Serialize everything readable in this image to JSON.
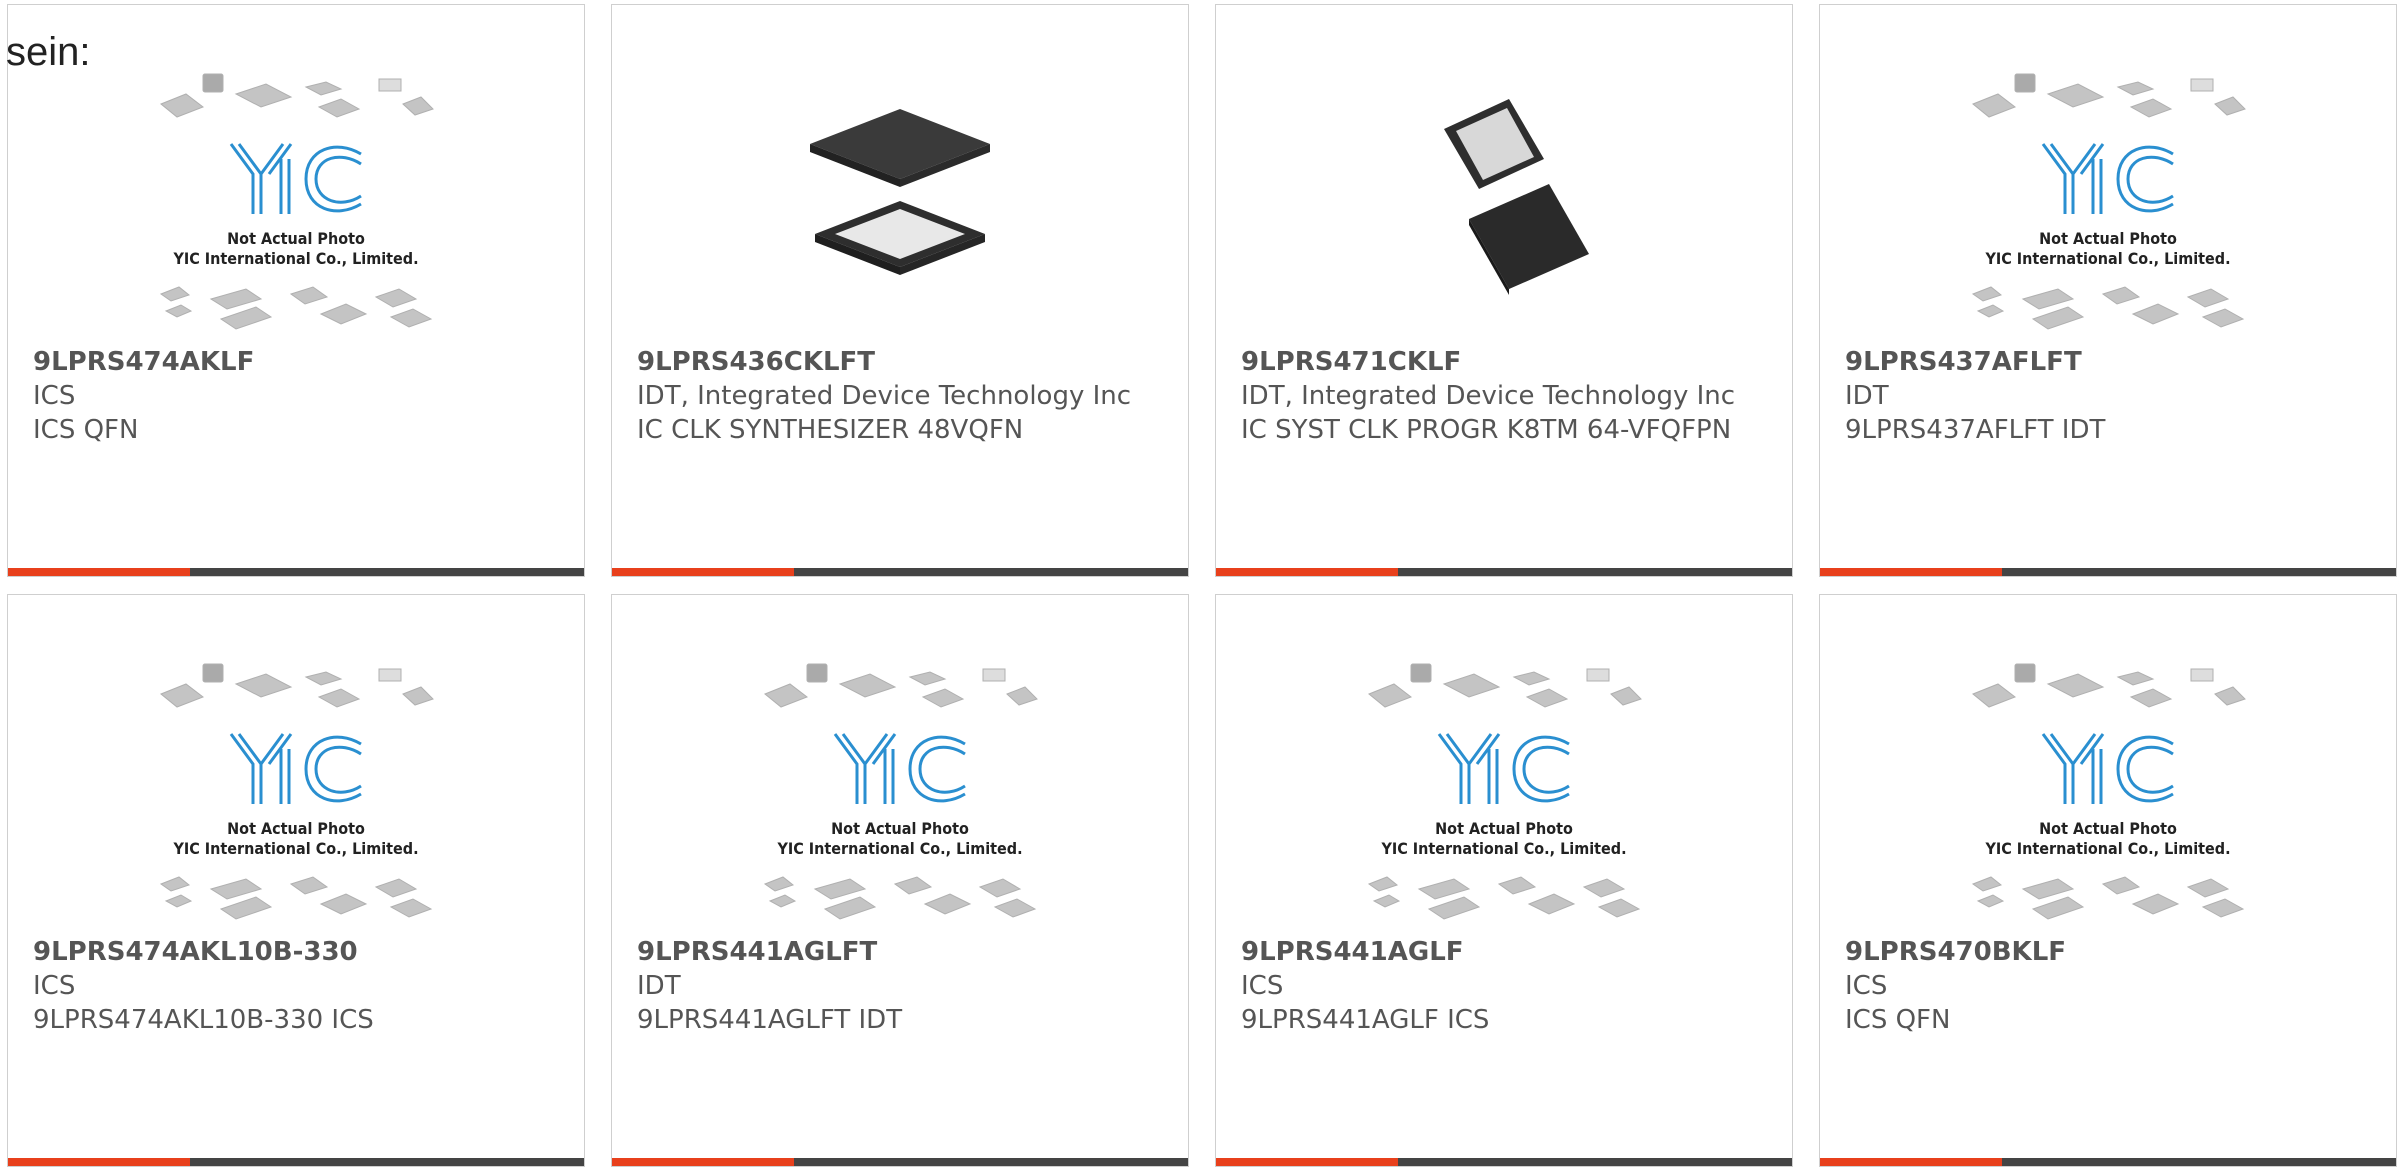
{
  "intro_text": "sein:",
  "placeholder": {
    "line1": "Not Actual Photo",
    "line2": "YIC International Co., Limited.",
    "logo": "YIC"
  },
  "colors": {
    "accent": "#e8401c",
    "bar": "#444444",
    "text": "#555555",
    "logo": "#2a8fd0"
  },
  "products": [
    {
      "pn": "9LPRS474AKLF",
      "maker": "ICS",
      "desc": "ICS QFN",
      "image": "placeholder"
    },
    {
      "pn": "9LPRS436CKLFT",
      "maker": "IDT, Integrated Device Technology Inc",
      "desc": "IC CLK SYNTHESIZER 48VQFN",
      "image": "qfn-chip-photo"
    },
    {
      "pn": "9LPRS471CKLF",
      "maker": "IDT, Integrated Device Technology Inc",
      "desc": "IC SYST CLK PROGR K8TM 64-VFQFPN",
      "image": "vfqfpn-chip-photo"
    },
    {
      "pn": "9LPRS437AFLFT",
      "maker": "IDT",
      "desc": "9LPRS437AFLFT IDT",
      "image": "placeholder"
    },
    {
      "pn": "9LPRS474AKL10B-330",
      "maker": "ICS",
      "desc": "9LPRS474AKL10B-330 ICS",
      "image": "placeholder"
    },
    {
      "pn": "9LPRS441AGLFT",
      "maker": "IDT",
      "desc": "9LPRS441AGLFT IDT",
      "image": "placeholder"
    },
    {
      "pn": "9LPRS441AGLF",
      "maker": "ICS",
      "desc": "9LPRS441AGLF ICS",
      "image": "placeholder"
    },
    {
      "pn": "9LPRS470BKLF",
      "maker": "ICS",
      "desc": "ICS QFN",
      "image": "placeholder"
    }
  ]
}
